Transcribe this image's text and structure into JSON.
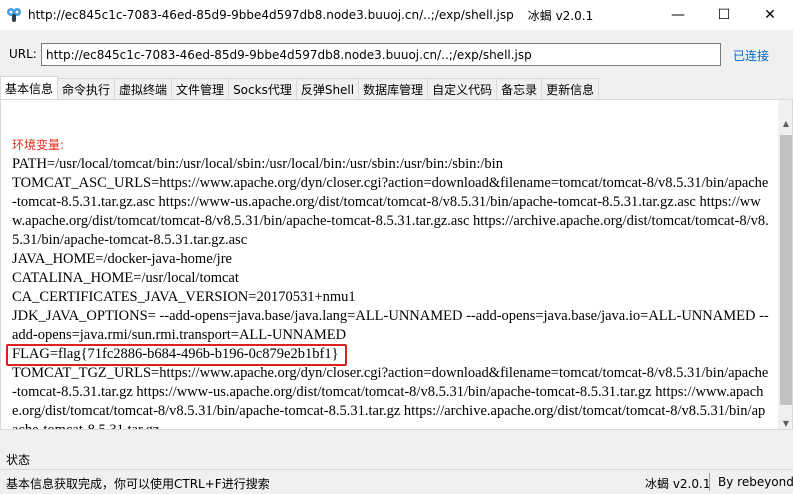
{
  "window": {
    "title": "http://ec845c1c-7083-46ed-85d9-9bbe4d597db8.node3.buuoj.cn/..;/exp/shell.jsp",
    "app_name": "冰蝎 v2.0.1",
    "minimize_glyph": "—",
    "maximize_glyph": "☐",
    "close_glyph": "✕",
    "icon": "app-icon"
  },
  "urlbar": {
    "label": "URL:",
    "value": "http://ec845c1c-7083-46ed-85d9-9bbe4d597db8.node3.buuoj.cn/..;/exp/shell.jsp",
    "status": "已连接"
  },
  "tabs": [
    {
      "label": "基本信息",
      "active": true
    },
    {
      "label": "命令执行"
    },
    {
      "label": "虚拟终端"
    },
    {
      "label": "文件管理"
    },
    {
      "label": "Socks代理"
    },
    {
      "label": "反弹Shell"
    },
    {
      "label": "数据库管理"
    },
    {
      "label": "自定义代码"
    },
    {
      "label": "备忘录"
    },
    {
      "label": "更新信息"
    }
  ],
  "content": {
    "env_heading": "环境变量:",
    "lines": [
      "PATH=/usr/local/tomcat/bin:/usr/local/sbin:/usr/local/bin:/usr/sbin:/usr/bin:/sbin:/bin",
      "TOMCAT_ASC_URLS=https://www.apache.org/dyn/closer.cgi?action=download&filename=tomcat/tomcat-8/v8.5.31/bin/apache-tomcat-8.5.31.tar.gz.asc https://www-us.apache.org/dist/tomcat/tomcat-8/v8.5.31/bin/apache-tomcat-8.5.31.tar.gz.asc https://www.apache.org/dist/tomcat/tomcat-8/v8.5.31/bin/apache-tomcat-8.5.31.tar.gz.asc https://archive.apache.org/dist/tomcat/tomcat-8/v8.5.31/bin/apache-tomcat-8.5.31.tar.gz.asc",
      "JAVA_HOME=/docker-java-home/jre",
      "CATALINA_HOME=/usr/local/tomcat",
      "CA_CERTIFICATES_JAVA_VERSION=20170531+nmu1",
      "JDK_JAVA_OPTIONS= --add-opens=java.base/java.lang=ALL-UNNAMED --add-opens=java.base/java.io=ALL-UNNAMED --add-opens=java.rmi/sun.rmi.transport=ALL-UNNAMED",
      "FLAG=flag{71fc2886-b684-496b-b196-0c879e2b1bf1}",
      "TOMCAT_TGZ_URLS=https://www.apache.org/dyn/closer.cgi?action=download&filename=tomcat/tomcat-8/v8.5.31/bin/apache-tomcat-8.5.31.tar.gz https://www-us.apache.org/dist/tomcat/tomcat-8/v8.5.31/bin/apache-tomcat-8.5.31.tar.gz https://www.apache.org/dist/tomcat/tomcat-8/v8.5.31/bin/apache-tomcat-8.5.31.tar.gz https://archive.apache.org/dist/tomcat/tomcat-8/v8.5.31/bin/apache-tomcat-8.5.31.tar.gz"
    ],
    "highlight_color": "#e02020"
  },
  "status": {
    "section_label": "状态",
    "message": "基本信息获取完成，你可以使用CTRL+F进行搜索",
    "version": "冰蝎 v2.0.1",
    "author": "By rebeyond"
  },
  "colors": {
    "accent_link": "#0066cc",
    "env_heading": "#e0301e"
  }
}
